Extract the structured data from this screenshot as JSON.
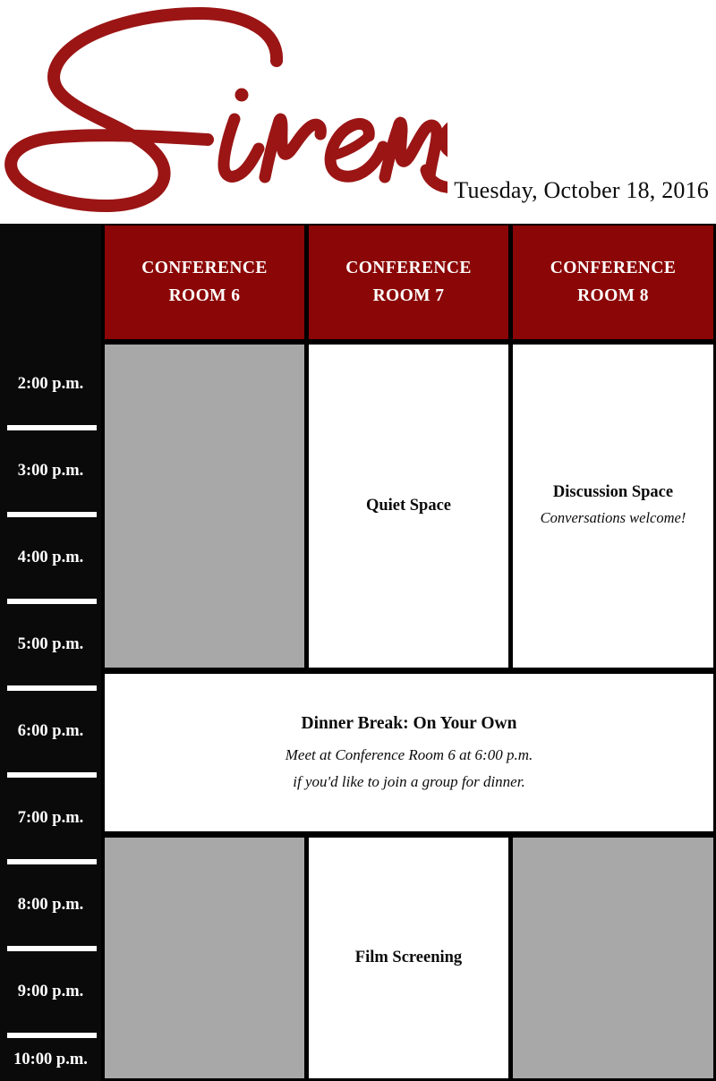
{
  "header": {
    "logo_text": "Sirens",
    "logo_color": "#9b1515",
    "date": "Tuesday, October 18, 2016"
  },
  "theme": {
    "header_red": "#8b0606",
    "black": "#0a0a0a",
    "gray": "#a8a8a8",
    "white": "#ffffff"
  },
  "schedule": {
    "corner_label": "",
    "columns": [
      {
        "line1": "CONFERENCE",
        "line2": "ROOM 6"
      },
      {
        "line1": "CONFERENCE",
        "line2": "ROOM 7"
      },
      {
        "line1": "CONFERENCE",
        "line2": "ROOM 8"
      }
    ],
    "times": [
      "2:00 p.m.",
      "3:00 p.m.",
      "4:00 p.m.",
      "5:00 p.m.",
      "6:00 p.m.",
      "7:00 p.m.",
      "8:00 p.m.",
      "9:00 p.m.",
      "10:00 p.m."
    ],
    "events": {
      "afternoon_room6": {
        "title": "",
        "subtitle": ""
      },
      "afternoon_room7": {
        "title": "Quiet Space",
        "subtitle": ""
      },
      "afternoon_room8": {
        "title": "Discussion Space",
        "subtitle": "Conversations welcome!"
      },
      "dinner": {
        "title": "Dinner Break: On Your Own",
        "line1": "Meet at Conference Room 6 at 6:00 p.m.",
        "line2": "if you'd like to join a group for dinner."
      },
      "evening_room6": {
        "title": "",
        "subtitle": ""
      },
      "evening_room7": {
        "title": "Film Screening",
        "subtitle": ""
      },
      "evening_room8": {
        "title": "",
        "subtitle": ""
      }
    }
  }
}
